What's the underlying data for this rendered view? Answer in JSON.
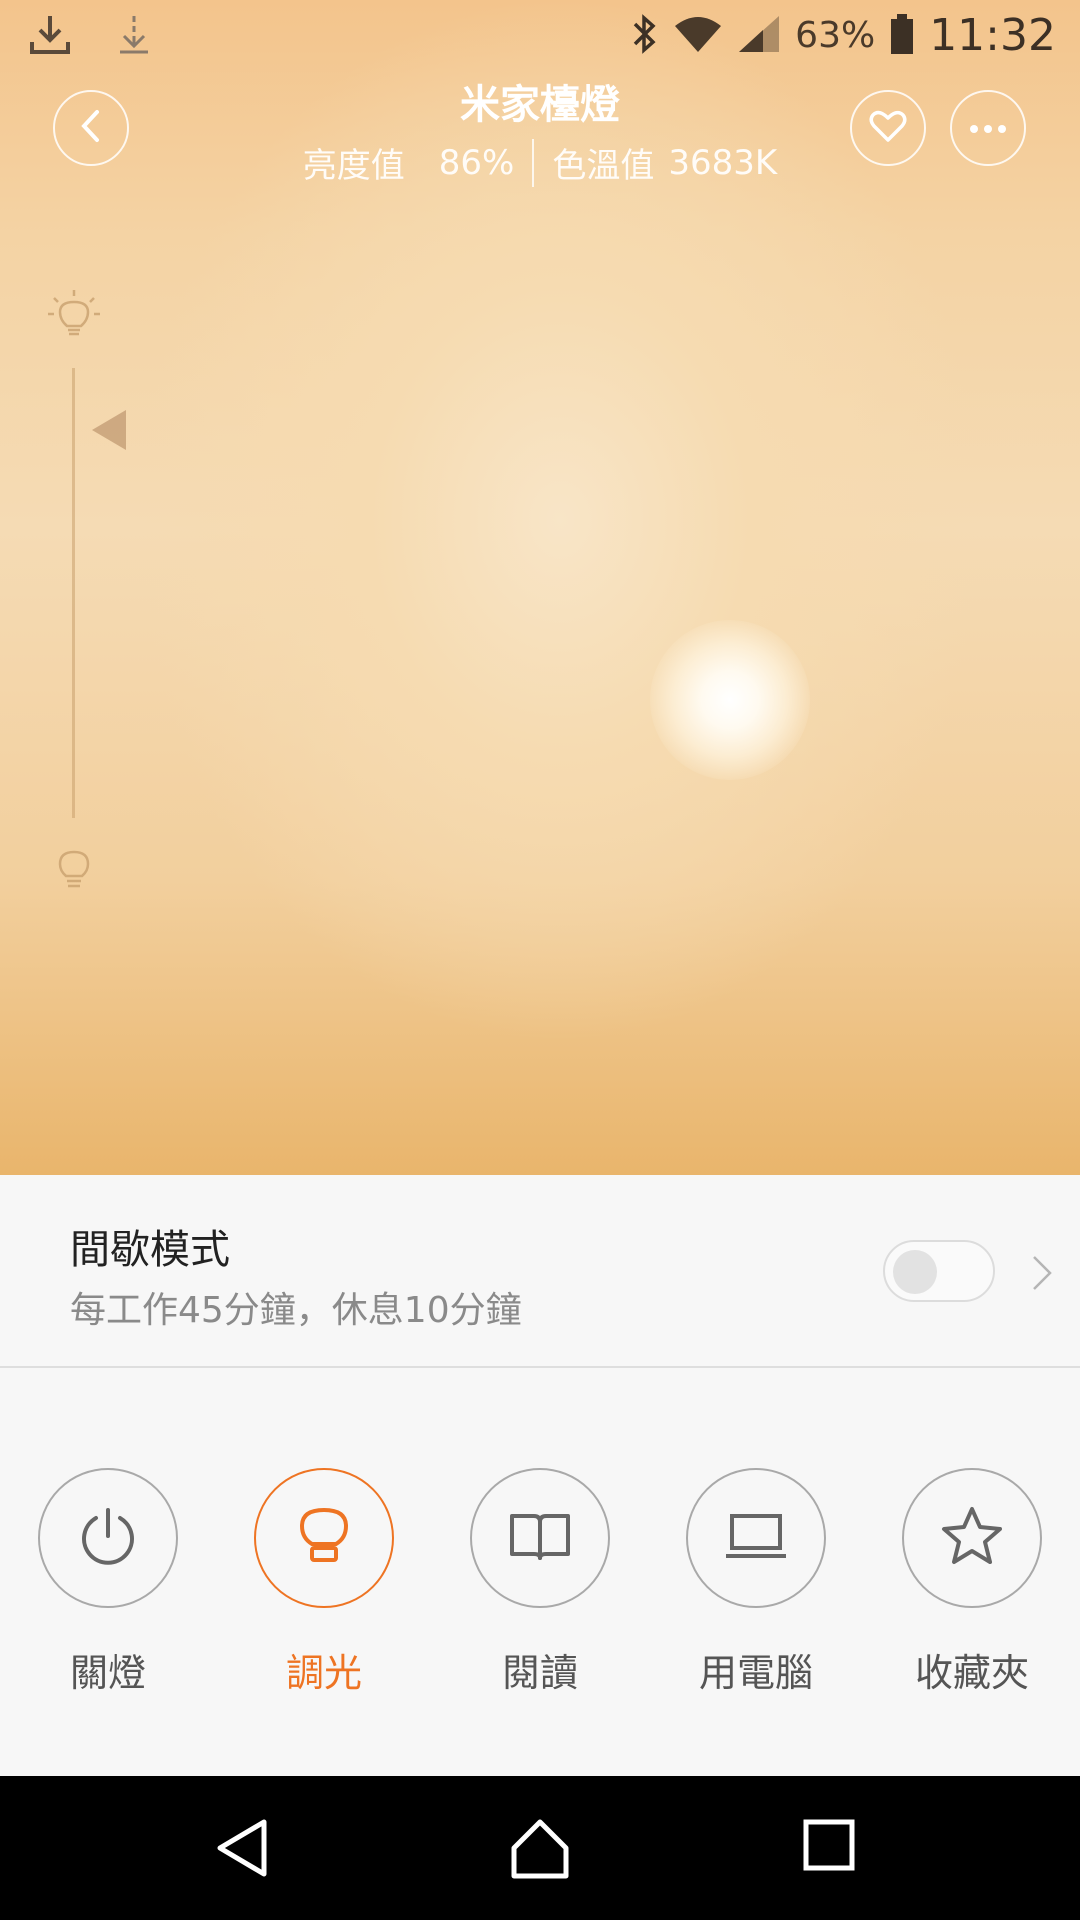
{
  "status_bar": {
    "battery_percent": "63%",
    "time": "11:32",
    "icons": [
      "download-icon",
      "download-small-icon",
      "bluetooth-icon",
      "wifi-icon",
      "signal-icon",
      "battery-icon"
    ]
  },
  "header": {
    "title": "米家檯燈",
    "brightness_label": "亮度值",
    "brightness_value": "86%",
    "color_temp_label": "色溫值",
    "color_temp_value": "3683K"
  },
  "colors": {
    "accent": "#ee7423",
    "lamp_warm": "#f5dbb4",
    "inactive_border": "#a9a9a9"
  },
  "slider": {
    "level": 0.86
  },
  "mode_card": {
    "title": "間歇模式",
    "description": "每工作45分鐘，休息10分鐘",
    "enabled": false
  },
  "scenes": [
    {
      "label": "關燈",
      "icon": "power-icon",
      "active": false
    },
    {
      "label": "調光",
      "icon": "bulb-icon",
      "active": true
    },
    {
      "label": "閱讀",
      "icon": "book-icon",
      "active": false
    },
    {
      "label": "用電腦",
      "icon": "laptop-icon",
      "active": false
    },
    {
      "label": "收藏夾",
      "icon": "star-icon",
      "active": false
    }
  ]
}
